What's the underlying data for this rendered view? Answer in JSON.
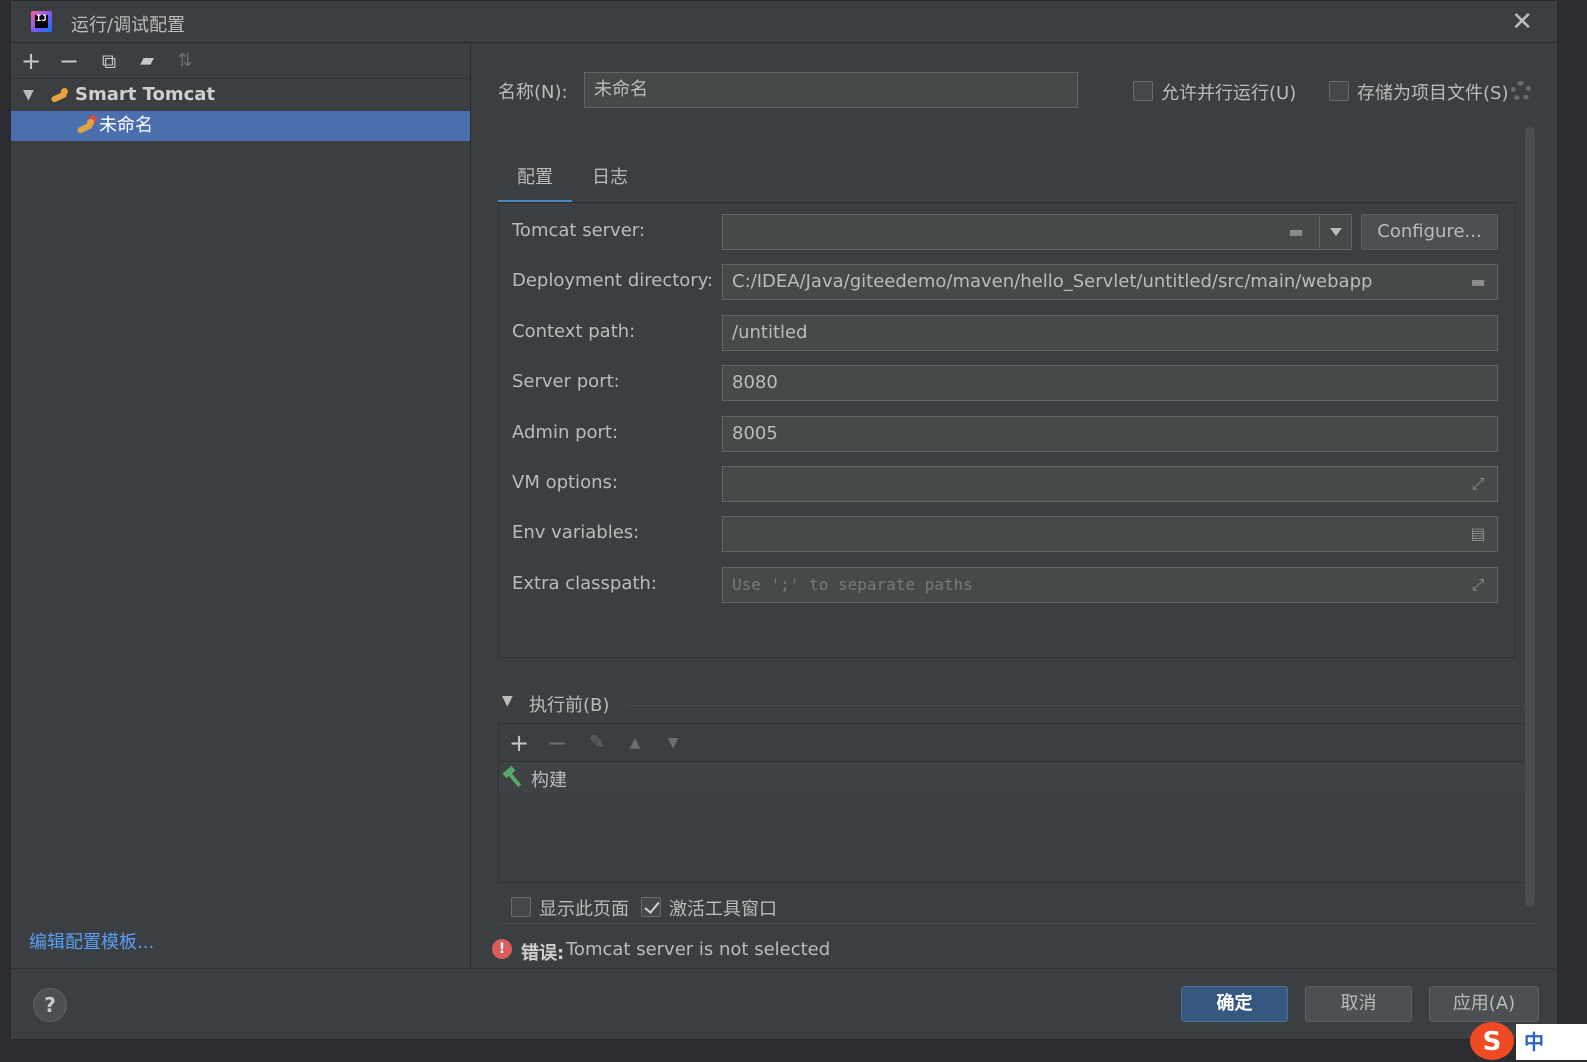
{
  "window": {
    "title": "运行/调试配置",
    "app_icon_text": "IJ"
  },
  "tree": {
    "group_label": "Smart Tomcat",
    "item_label": "未命名",
    "edit_templates": "编辑配置模板..."
  },
  "header": {
    "name_label": "名称(N):",
    "name_value": "未命名",
    "allow_parallel": "允许并行运行(U)",
    "store_as_project": "存储为项目文件(S)"
  },
  "tabs": [
    {
      "label": "配置"
    },
    {
      "label": "日志"
    }
  ],
  "config": {
    "tomcat_server_label": "Tomcat server:",
    "tomcat_server_value": "",
    "configure_button": "Configure...",
    "deployment_label": "Deployment directory:",
    "deployment_value": "C:/IDEA/Java/giteedemo/maven/hello_Servlet/untitled/src/main/webapp",
    "context_label": "Context path:",
    "context_value": "/untitled",
    "server_port_label": "Server port:",
    "server_port_value": "8080",
    "admin_port_label": "Admin port:",
    "admin_port_value": "8005",
    "vm_options_label": "VM options:",
    "vm_options_value": "",
    "env_label": "Env variables:",
    "env_value": "",
    "classpath_label": "Extra classpath:",
    "classpath_placeholder": "Use ';' to separate paths"
  },
  "before_launch": {
    "header": "执行前(B)",
    "task": "构建"
  },
  "options": {
    "show_page": "显示此页面",
    "activate_tool_window": "激活工具窗口",
    "show_page_checked": false,
    "activate_checked": true
  },
  "error": {
    "prefix": "错误:",
    "message": "Tomcat server is not selected"
  },
  "buttons": {
    "ok": "确定",
    "cancel": "取消",
    "apply": "应用(A)",
    "help": "?"
  },
  "ime": {
    "sogou": "S",
    "mode": "中"
  },
  "colors": {
    "background": "#3c3f41",
    "selection": "#4b6eaf",
    "link": "#589df6",
    "primary_button": "#365880",
    "error": "#db5c5c"
  }
}
